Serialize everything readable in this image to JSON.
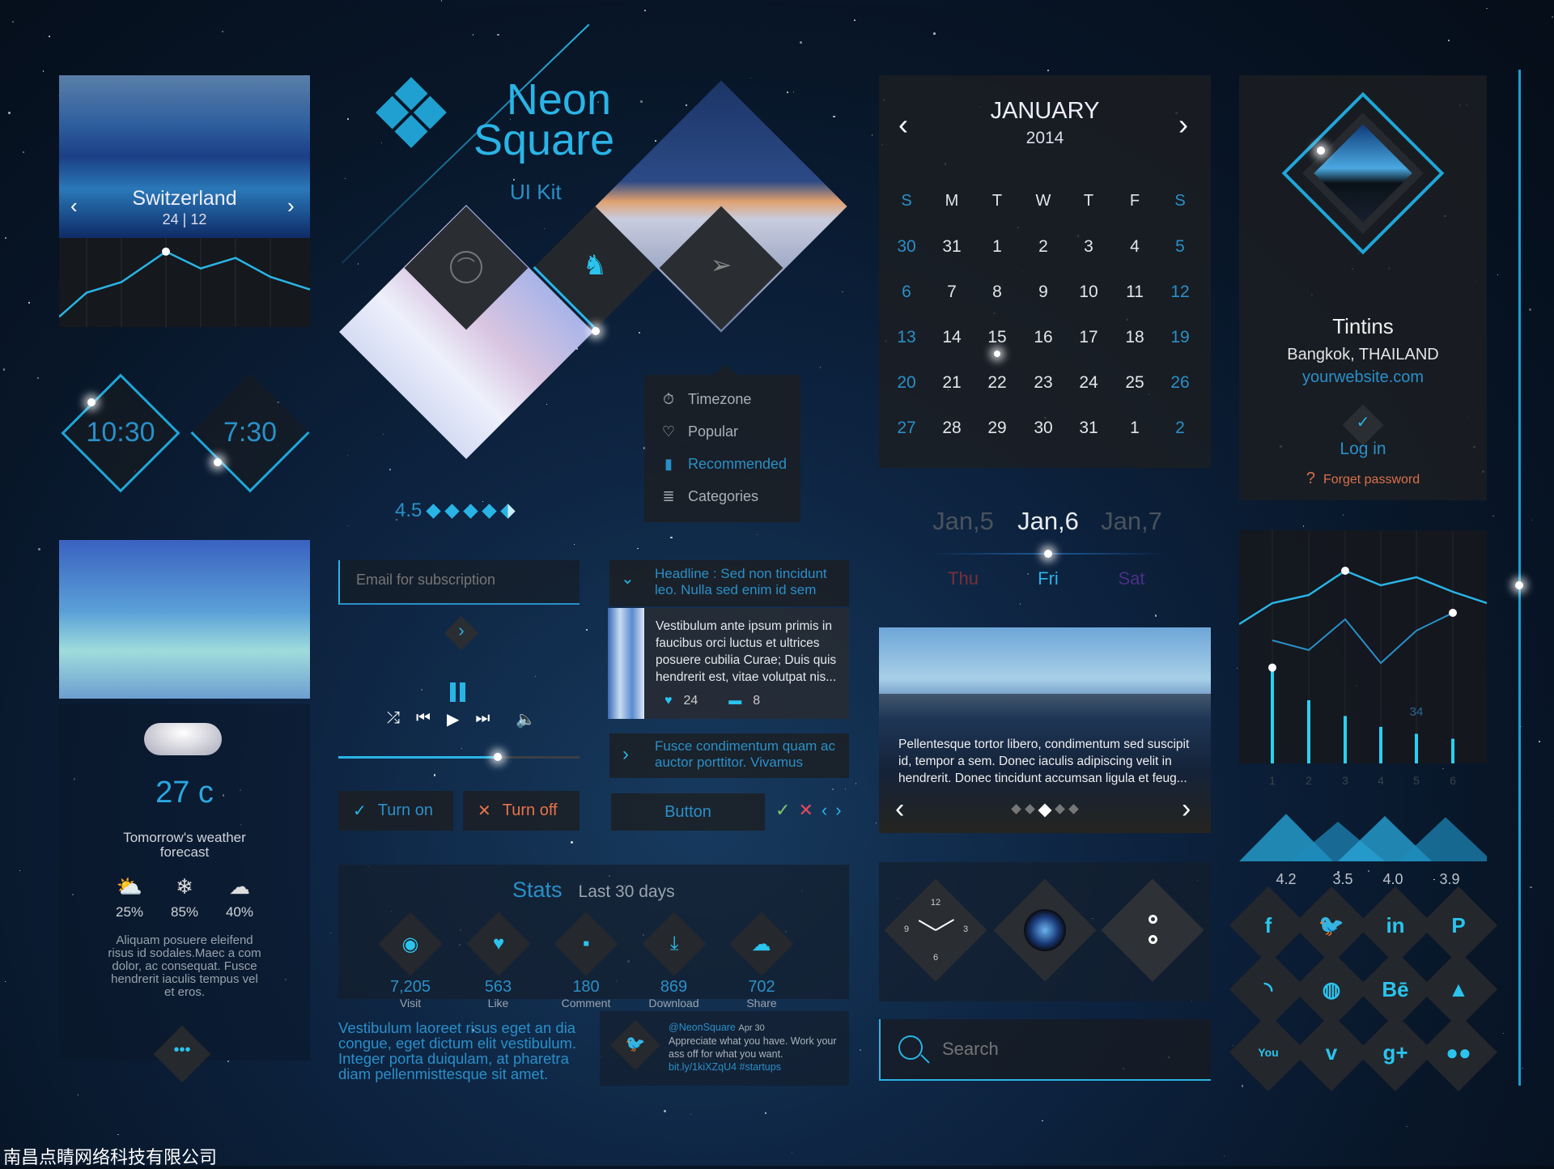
{
  "colors": {
    "accent": "#2ab4e6",
    "turn_off": "#e8734a",
    "check": "#7ec96a",
    "cross": "#e84a5a",
    "thu": "#7a2f3a",
    "sat": "#4a2f86",
    "forget": "#d9704a"
  },
  "brand": {
    "line1": "Neon",
    "line2": "Square",
    "subtitle": "UI Kit"
  },
  "photo_card": {
    "title": "Switzerland",
    "date": "24 | 12",
    "prev_icon": "chevron-left",
    "next_icon": "chevron-right"
  },
  "mini_chart": {
    "type": "line",
    "values": [
      2,
      25,
      35,
      64,
      48,
      58,
      40,
      28
    ]
  },
  "clocks": [
    "10:30",
    "7:30"
  ],
  "rating": {
    "value": "4.5",
    "stars": 4.5,
    "max": 5
  },
  "menu": {
    "items": [
      {
        "label": "Timezone",
        "icon": "stopwatch-icon",
        "active": false
      },
      {
        "label": "Popular",
        "icon": "heart-icon",
        "active": false
      },
      {
        "label": "Recommended",
        "icon": "flashlight-icon",
        "active": true
      },
      {
        "label": "Categories",
        "icon": "list-icon",
        "active": false
      }
    ]
  },
  "calendar": {
    "month": "JANUARY",
    "year": "2014",
    "weekdays": [
      "S",
      "M",
      "T",
      "W",
      "T",
      "F",
      "S"
    ],
    "weeks": [
      [
        "30",
        "31",
        "1",
        "2",
        "3",
        "4",
        "5"
      ],
      [
        "6",
        "7",
        "8",
        "9",
        "10",
        "11",
        "12"
      ],
      [
        "13",
        "14",
        "15",
        "16",
        "17",
        "18",
        "19"
      ],
      [
        "20",
        "21",
        "22",
        "23",
        "24",
        "25",
        "26"
      ],
      [
        "27",
        "28",
        "29",
        "30",
        "31",
        "1",
        "2"
      ]
    ],
    "selected": "15"
  },
  "profile": {
    "name": "Tintins",
    "location": "Bangkok, THAILAND",
    "website": "yourwebsite.com",
    "login": "Log in",
    "forgot": "Forget password",
    "forgot_icon": "?"
  },
  "date_picker": {
    "dates": [
      "Jan,5",
      "Jan,6",
      "Jan,7"
    ],
    "days": [
      "Thu",
      "Fri",
      "Sat"
    ],
    "selected": 1
  },
  "weather": {
    "temp": "27 c",
    "title": "Tomorrow's weather forecast",
    "stats": [
      {
        "icon": "partly-sunny-icon",
        "value": "25%"
      },
      {
        "icon": "snowflake-icon",
        "value": "85%"
      },
      {
        "icon": "wind-icon",
        "value": "40%"
      }
    ],
    "text": "Aliquam posuere eleifend risus id sodales.Maec a com dolor, ac consequat. Fusce hendrerit iaculis tempus vel et eros."
  },
  "subscribe": {
    "placeholder": "Email for subscription"
  },
  "player": {
    "progress": 0.5
  },
  "toggles": {
    "on": "Turn on",
    "off": "Turn off"
  },
  "accordion": {
    "headline": "Headline : Sed non tincidunt leo. Nulla sed enim id sem",
    "article": "Vestibulum ante ipsum primis in faucibus orci luctus et ultrices posuere cubilia Curae; Duis quis hendrerit est, vitae volutpat nis...",
    "likes": "24",
    "comments": "8",
    "collapsed": "Fusce condimentum quam ac auctor porttitor. Vivamus"
  },
  "button": {
    "label": "Button"
  },
  "slider_card": {
    "text": "Pellentesque tortor libero, condimentum sed suscipit id, tempor a sem. Donec iaculis adipiscing velit in hendrerit. Donec tincidunt accumsan ligula et feug...",
    "dots": 5,
    "active_dot": 2
  },
  "stats": {
    "title": "Stats",
    "period": "Last 30 days",
    "items": [
      {
        "icon": "eye-icon",
        "value": "7,205",
        "label": "Visit"
      },
      {
        "icon": "heart-icon",
        "value": "563",
        "label": "Like"
      },
      {
        "icon": "comment-icon",
        "value": "180",
        "label": "Comment"
      },
      {
        "icon": "download-icon",
        "value": "869",
        "label": "Download"
      },
      {
        "icon": "cloud-upload-icon",
        "value": "702",
        "label": "Share"
      }
    ]
  },
  "quote": "Vestibulum laoreet risus eget an dia congue, eget dictum elit vestibulum. Integer porta duiqulam, at pharetra diam pellenmisttesque sit amet.",
  "tweet": {
    "handle": "@NeonSquare",
    "date": "Apr 30",
    "text": "Appreciate what you have. Work your ass off for what you want.",
    "link": "bit.ly/1kiXZqU4 #startups"
  },
  "clock_widget": {
    "numbers": [
      "12",
      "3",
      "6",
      "9"
    ]
  },
  "search": {
    "placeholder": "Search"
  },
  "chart_data": [
    {
      "type": "line",
      "series": [
        {
          "values": [
            42,
            55,
            60,
            75,
            66,
            71,
            62,
            55
          ]
        },
        {
          "values": [
            32,
            26,
            45,
            18,
            38,
            49
          ]
        }
      ]
    },
    {
      "type": "bar",
      "categories": [
        "1",
        "2",
        "3",
        "4",
        "5",
        "6"
      ],
      "values": [
        97,
        64,
        48,
        37,
        30,
        25
      ],
      "annotation": "34"
    },
    {
      "type": "area",
      "values": [
        4.2,
        3.5,
        4.0,
        3.9
      ],
      "labels": [
        "4.2",
        "3.5",
        "4.0",
        "3.9"
      ]
    }
  ],
  "social": [
    {
      "icon": "facebook-icon",
      "glyph": "f"
    },
    {
      "icon": "twitter-icon",
      "glyph": "🐦"
    },
    {
      "icon": "linkedin-icon",
      "glyph": "in"
    },
    {
      "icon": "pinterest-icon",
      "glyph": "P"
    },
    {
      "icon": "rss-icon",
      "glyph": "◝"
    },
    {
      "icon": "dribbble-icon",
      "glyph": "◍"
    },
    {
      "icon": "behance-icon",
      "glyph": "Bē"
    },
    {
      "icon": "forrst-icon",
      "glyph": "▲"
    },
    {
      "icon": "youtube-icon",
      "glyph": "You"
    },
    {
      "icon": "vimeo-icon",
      "glyph": "v"
    },
    {
      "icon": "google-plus-icon",
      "glyph": "g+"
    },
    {
      "icon": "flickr-icon",
      "glyph": "●●"
    }
  ],
  "watermark": "南昌点睛网络科技有限公司"
}
